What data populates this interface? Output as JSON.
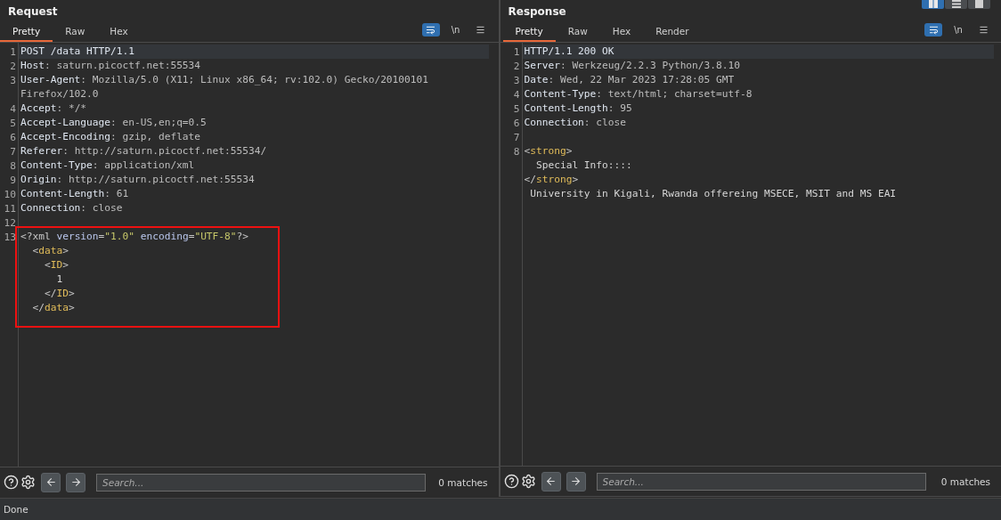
{
  "layout_buttons": [
    {
      "kind": "columns",
      "selected": true
    },
    {
      "kind": "rows",
      "selected": false
    },
    {
      "kind": "single",
      "selected": false
    }
  ],
  "panes": [
    {
      "title": "Request",
      "tabs": [
        {
          "label": "Pretty",
          "selected": true
        },
        {
          "label": "Raw",
          "selected": false
        },
        {
          "label": "Hex",
          "selected": false
        }
      ],
      "toolbar": [
        {
          "kind": "wrap",
          "on": true
        },
        {
          "kind": "newline",
          "label": "\\n",
          "on": false
        },
        {
          "kind": "menu",
          "on": false
        }
      ],
      "lines": [
        {
          "number": "1",
          "current": true,
          "tokens": [
            {
              "kind": "key",
              "text": "POST /data HTTP/1.1"
            }
          ]
        },
        {
          "number": "2",
          "current": false,
          "tokens": [
            {
              "kind": "key",
              "text": "Host"
            },
            {
              "kind": "value",
              "text": ": saturn.picoctf.net:55534"
            }
          ]
        },
        {
          "number": "3",
          "current": false,
          "tokens": [
            {
              "kind": "key",
              "text": "User-Agent"
            },
            {
              "kind": "value",
              "text": ": Mozilla/5.0 (X11; Linux x86_64; rv:102.0) Gecko/20100101"
            }
          ]
        },
        {
          "current": false,
          "tokens": [
            {
              "kind": "value",
              "text": "Firefox/102.0"
            }
          ]
        },
        {
          "number": "4",
          "current": false,
          "tokens": [
            {
              "kind": "key",
              "text": "Accept"
            },
            {
              "kind": "value",
              "text": ": */*"
            }
          ]
        },
        {
          "number": "5",
          "current": false,
          "tokens": [
            {
              "kind": "key",
              "text": "Accept-Language"
            },
            {
              "kind": "value",
              "text": ": en-US,en;q=0.5"
            }
          ]
        },
        {
          "number": "6",
          "current": false,
          "tokens": [
            {
              "kind": "key",
              "text": "Accept-Encoding"
            },
            {
              "kind": "value",
              "text": ": gzip, deflate"
            }
          ]
        },
        {
          "number": "7",
          "current": false,
          "tokens": [
            {
              "kind": "key",
              "text": "Referer"
            },
            {
              "kind": "value",
              "text": ": http://saturn.picoctf.net:55534/"
            }
          ]
        },
        {
          "number": "8",
          "current": false,
          "tokens": [
            {
              "kind": "key",
              "text": "Content-Type"
            },
            {
              "kind": "value",
              "text": ": application/xml"
            }
          ]
        },
        {
          "number": "9",
          "current": false,
          "tokens": [
            {
              "kind": "key",
              "text": "Origin"
            },
            {
              "kind": "value",
              "text": ": http://saturn.picoctf.net:55534"
            }
          ]
        },
        {
          "number": "10",
          "current": false,
          "tokens": [
            {
              "kind": "key",
              "text": "Content-Length"
            },
            {
              "kind": "value",
              "text": ": 61"
            }
          ]
        },
        {
          "number": "11",
          "current": false,
          "tokens": [
            {
              "kind": "key",
              "text": "Connection"
            },
            {
              "kind": "value",
              "text": ": close"
            }
          ]
        },
        {
          "number": "12",
          "current": false
        }
      ],
      "boxed_lines": [
        {
          "number": "13",
          "current": false,
          "tokens": [
            {
              "kind": "punct",
              "text": "<?xml "
            },
            {
              "kind": "attr",
              "text": "version"
            },
            {
              "kind": "punct",
              "text": "="
            },
            {
              "kind": "string",
              "text": "\"1.0\""
            },
            {
              "kind": "attr",
              "text": " encoding"
            },
            {
              "kind": "punct",
              "text": "="
            },
            {
              "kind": "string",
              "text": "\"UTF-8\""
            },
            {
              "kind": "punct",
              "text": "?>"
            }
          ]
        },
        {
          "current": false,
          "tokens": [
            {
              "kind": "punct",
              "text": "  <"
            },
            {
              "kind": "tag",
              "text": "data"
            },
            {
              "kind": "punct",
              "text": ">"
            }
          ]
        },
        {
          "current": false,
          "tokens": [
            {
              "kind": "punct",
              "text": "    <"
            },
            {
              "kind": "tag",
              "text": "ID"
            },
            {
              "kind": "punct",
              "text": ">"
            }
          ]
        },
        {
          "current": false,
          "tokens": [
            {
              "kind": "text",
              "text": "      1"
            }
          ]
        },
        {
          "current": false,
          "tokens": [
            {
              "kind": "punct",
              "text": "    </"
            },
            {
              "kind": "tag",
              "text": "ID"
            },
            {
              "kind": "punct",
              "text": ">"
            }
          ]
        },
        {
          "current": false,
          "tokens": [
            {
              "kind": "punct",
              "text": "  </"
            },
            {
              "kind": "tag",
              "text": "data"
            },
            {
              "kind": "punct",
              "text": ">"
            }
          ]
        }
      ],
      "search": {
        "placeholder": "Search...",
        "matches": "0 matches"
      }
    },
    {
      "title": "Response",
      "tabs": [
        {
          "label": "Pretty",
          "selected": true
        },
        {
          "label": "Raw",
          "selected": false
        },
        {
          "label": "Hex",
          "selected": false
        },
        {
          "label": "Render",
          "selected": false
        }
      ],
      "toolbar": [
        {
          "kind": "wrap",
          "on": true
        },
        {
          "kind": "newline",
          "label": "\\n",
          "on": false
        },
        {
          "kind": "menu",
          "on": false
        }
      ],
      "lines": [
        {
          "number": "1",
          "current": true,
          "tokens": [
            {
              "kind": "key",
              "text": "HTTP/1.1 200 OK"
            }
          ]
        },
        {
          "number": "2",
          "current": false,
          "tokens": [
            {
              "kind": "key",
              "text": "Server"
            },
            {
              "kind": "value",
              "text": ": Werkzeug/2.2.3 Python/3.8.10"
            }
          ]
        },
        {
          "number": "3",
          "current": false,
          "tokens": [
            {
              "kind": "key",
              "text": "Date"
            },
            {
              "kind": "value",
              "text": ": Wed, 22 Mar 2023 17:28:05 GMT"
            }
          ]
        },
        {
          "number": "4",
          "current": false,
          "tokens": [
            {
              "kind": "key",
              "text": "Content-Type"
            },
            {
              "kind": "value",
              "text": ": text/html; charset=utf-8"
            }
          ]
        },
        {
          "number": "5",
          "current": false,
          "tokens": [
            {
              "kind": "key",
              "text": "Content-Length"
            },
            {
              "kind": "value",
              "text": ": 95"
            }
          ]
        },
        {
          "number": "6",
          "current": false,
          "tokens": [
            {
              "kind": "key",
              "text": "Connection"
            },
            {
              "kind": "value",
              "text": ": close"
            }
          ]
        },
        {
          "number": "7",
          "current": false
        },
        {
          "number": "8",
          "current": false,
          "tokens": [
            {
              "kind": "punct",
              "text": "<"
            },
            {
              "kind": "tag",
              "text": "strong"
            },
            {
              "kind": "punct",
              "text": ">"
            }
          ]
        },
        {
          "current": false,
          "tokens": [
            {
              "kind": "text",
              "text": "  Special Info::::"
            }
          ]
        },
        {
          "current": false,
          "tokens": [
            {
              "kind": "punct",
              "text": "</"
            },
            {
              "kind": "tag",
              "text": "strong"
            },
            {
              "kind": "punct",
              "text": ">"
            }
          ]
        },
        {
          "current": false,
          "tokens": [
            {
              "kind": "text",
              "text": " University in Kigali, Rwanda offereing MSECE, MSIT and MS EAI"
            }
          ]
        }
      ],
      "search": {
        "placeholder": "Search...",
        "matches": "0 matches"
      }
    }
  ],
  "status": "Done"
}
